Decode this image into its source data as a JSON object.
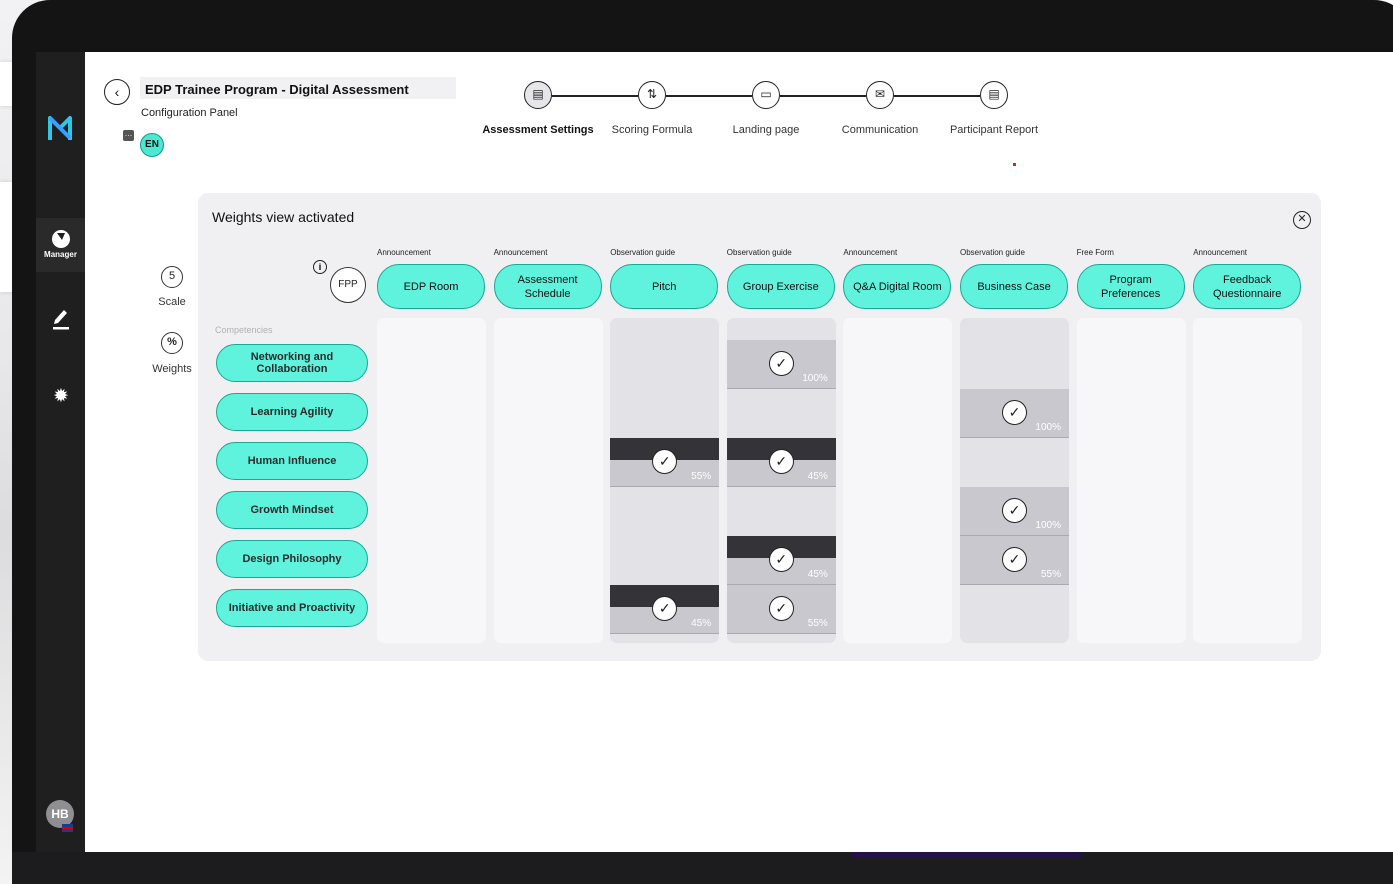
{
  "colors": {
    "accent": "#5ff2dc",
    "accent_border": "#19a894",
    "sidebar": "#1f1f1f",
    "panel": "#f0f0f3"
  },
  "sidebar": {
    "logo_icon": "brand-logo-icon",
    "nav": [
      {
        "icon": "bolt-icon",
        "label": "Manager",
        "active": true
      },
      {
        "icon": "pen-icon",
        "label": ""
      },
      {
        "icon": "gear-icon",
        "label": ""
      }
    ],
    "avatar": {
      "initials": "HB",
      "flag_icon": "uk-flag-icon"
    }
  },
  "header": {
    "title": "EDP Trainee Program - Digital Assessment",
    "subtitle": "Configuration Panel",
    "language": "EN",
    "back_icon": "chevron-left-icon"
  },
  "steps": [
    {
      "label": "Assessment Settings",
      "icon": "document-icon",
      "active": true
    },
    {
      "label": "Scoring Formula",
      "icon": "sort-icon"
    },
    {
      "label": "Landing page",
      "icon": "monitor-icon"
    },
    {
      "label": "Communication",
      "icon": "mail-icon"
    },
    {
      "label": "Participant Report",
      "icon": "document-icon"
    }
  ],
  "panel": {
    "title": "Weights view activated",
    "close_icon": "close-circle-icon",
    "scale": {
      "value": "5",
      "label": "Scale"
    },
    "weights": {
      "value": "%",
      "label": "Weights"
    },
    "fpp": "FPP",
    "info_icon": "info-icon",
    "competencies_label": "Competencies"
  },
  "competencies": [
    "Networking and Collaboration",
    "Learning Agility",
    "Human Influence",
    "Growth Mindset",
    "Design Philosophy",
    "Initiative and Proactivity"
  ],
  "activities": [
    {
      "type": "Announcement",
      "name": "EDP Room",
      "weights": []
    },
    {
      "type": "Announcement",
      "name": "Assessment Schedule",
      "weights": []
    },
    {
      "type": "Observation guide",
      "name": "Pitch",
      "weights": [
        {
          "row": 2,
          "pct": "55%"
        },
        {
          "row": 5,
          "pct": "45%"
        }
      ]
    },
    {
      "type": "Observation guide",
      "name": "Group Exercise",
      "weights": [
        {
          "row": 0,
          "pct": "100%"
        },
        {
          "row": 2,
          "pct": "45%"
        },
        {
          "row": 4,
          "pct": "45%"
        },
        {
          "row": 5,
          "pct": "55%"
        }
      ]
    },
    {
      "type": "Announcement",
      "name": "Q&A Digital Room",
      "weights": []
    },
    {
      "type": "Observation guide",
      "name": "Business Case",
      "weights": [
        {
          "row": 1,
          "pct": "100%"
        },
        {
          "row": 3,
          "pct": "100%"
        },
        {
          "row": 4,
          "pct": "55%"
        }
      ]
    },
    {
      "type": "Free Form",
      "name": "Program Preferences",
      "weights": []
    },
    {
      "type": "Announcement",
      "name": "Feedback Questionnaire",
      "weights": []
    }
  ]
}
